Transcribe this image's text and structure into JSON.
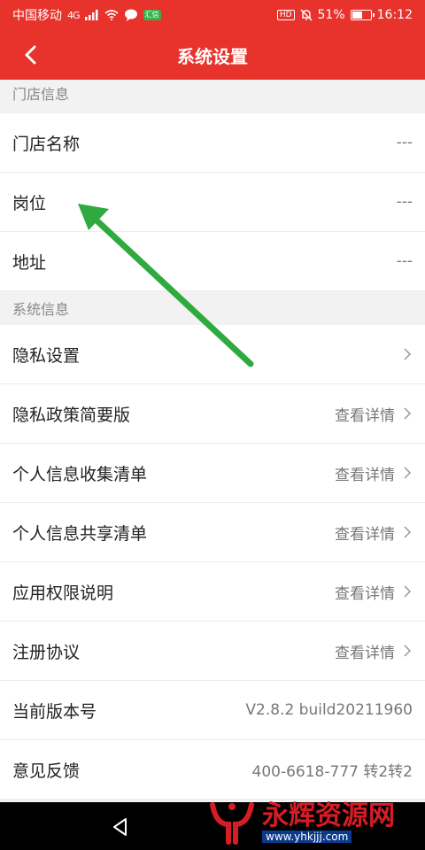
{
  "status_bar": {
    "carrier": "中国移动",
    "network": "4G",
    "hd_badge": "HD",
    "battery_text": "51%",
    "battery_level": 0.51,
    "time": "16:12",
    "app_badge": "汇信"
  },
  "nav": {
    "title": "系统设置"
  },
  "sections": {
    "store_header": "门店信息",
    "system_header": "系统信息"
  },
  "store_rows": [
    {
      "label": "门店名称",
      "value": "---"
    },
    {
      "label": "岗位",
      "value": "---"
    },
    {
      "label": "地址",
      "value": "---"
    }
  ],
  "system_rows": [
    {
      "label": "隐私设置",
      "value": ""
    },
    {
      "label": "隐私政策简要版",
      "value": "查看详情"
    },
    {
      "label": "个人信息收集清单",
      "value": "查看详情"
    },
    {
      "label": "个人信息共享清单",
      "value": "查看详情"
    },
    {
      "label": "应用权限说明",
      "value": "查看详情"
    },
    {
      "label": "注册协议",
      "value": "查看详情"
    },
    {
      "label": "当前版本号",
      "value": "V2.8.2 build20211960"
    },
    {
      "label": "意见反馈",
      "value": "400-6618-777 转2转2"
    }
  ],
  "watermark": {
    "title": "永辉资源网",
    "url": "www.yhkjjj.com"
  },
  "colors": {
    "brand_red": "#e8322c",
    "annotation_arrow": "#2eaa3f"
  },
  "icons": {
    "back": "chevron-left-icon",
    "row_arrow": "chevron-right-icon",
    "system_back": "triangle-back-icon"
  }
}
